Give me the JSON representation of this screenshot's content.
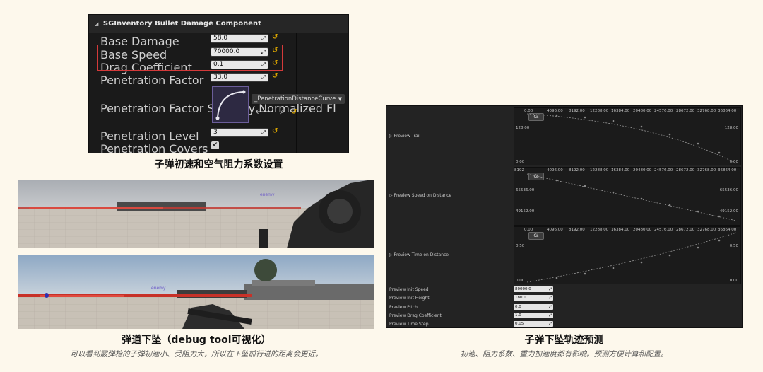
{
  "component_panel": {
    "title": "SGInventory Bullet Damage Component",
    "rows": [
      {
        "label": "Base Damage",
        "value": "58.0"
      },
      {
        "label": "Base Speed",
        "value": "70000.0"
      },
      {
        "label": "Drag Coefficient",
        "value": "0.1"
      },
      {
        "label": "Penetration Factor",
        "value": "33.0"
      },
      {
        "label": "Penetration Factor Scale by Normalized Fl",
        "value": ""
      },
      {
        "label": "Penetration Level",
        "value": "3"
      },
      {
        "label": "Penetration Covers",
        "value": ""
      }
    ],
    "curve_asset": "_PenetrationDistanceCurve",
    "reset_glyph": "↺",
    "checkbox_glyph": "✔",
    "highlight_color": "#d43a3a"
  },
  "captions": {
    "top_left": "子弹初速和空气阻力系数设置",
    "bottom_left": "弹道下坠（debug tool可视化）",
    "bottom_left_sub": "可以看到霰弹枪的子弹初速小、受阻力大，所以在下坠前行进的距离会更近。",
    "right": "子弹下坠轨迹预测",
    "right_sub": "初速、阻力系数、重力加速度都有影响。预测方便计算和配置。"
  },
  "scenes": {
    "hud_tag_1": "enemy",
    "hud_tag_2": "enemy"
  },
  "preview": {
    "x_ticks": [
      "0.00",
      "4096.00",
      "8192.00",
      "12288.00",
      "16384.00",
      "20480.00",
      "24576.00",
      "28672.00",
      "32768.00",
      "36864.00"
    ],
    "graphs": [
      {
        "label": "Preview Trail",
        "first_tick": "0.00",
        "y_upper": "128.00",
        "y_lower": "0.00",
        "bottom_right": "0.00"
      },
      {
        "label": "Preview Speed on Distance",
        "first_tick": "8192",
        "y_upper": "65536.00",
        "y_lower": "49152.00",
        "bottom_right": ""
      },
      {
        "label": "Preview Time on Distance",
        "first_tick": "0.00",
        "y_upper": "0.50",
        "y_lower": "0.00",
        "bottom_right": "0.00"
      }
    ],
    "graph_button": "Gℹ",
    "params": [
      {
        "label": "Preview Init Speed",
        "value": "80000.0"
      },
      {
        "label": "Preview Init Height",
        "value": "180.0"
      },
      {
        "label": "Preview Pitch",
        "value": "0.0"
      },
      {
        "label": "Preview Drag Coefficient",
        "value": "1.0"
      },
      {
        "label": "Preview Time Step",
        "value": "0.05"
      }
    ]
  }
}
